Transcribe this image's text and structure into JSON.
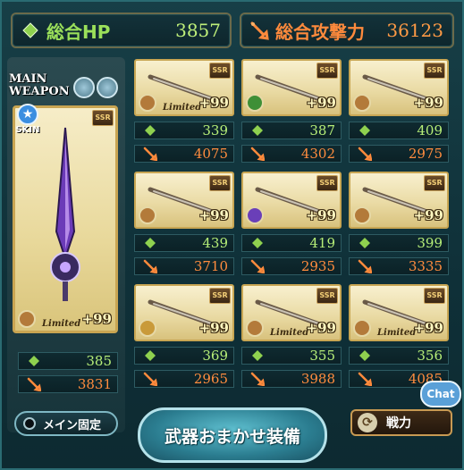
{
  "header": {
    "hp_label": "総合HP",
    "hp_value": "3857",
    "atk_label": "総合攻撃力",
    "atk_value": "36123"
  },
  "main_weapon": {
    "label_line1": "MAIN",
    "label_line2": "WEAPON",
    "skin_label": "SKIN",
    "rarity": "SSR",
    "plus": "+99",
    "tag": "Limited",
    "hp": "385",
    "atk": "3831"
  },
  "weapons": [
    {
      "rarity": "SSR",
      "plus": "+99",
      "tag": "Limited",
      "hp": "339",
      "atk": "4075",
      "element": "#b37a3a"
    },
    {
      "rarity": "SSR",
      "plus": "+99",
      "tag": "",
      "hp": "387",
      "atk": "4302",
      "element": "#3f8f36"
    },
    {
      "rarity": "SSR",
      "plus": "+99",
      "tag": "",
      "hp": "409",
      "atk": "2975",
      "element": "#b37a3a"
    },
    {
      "rarity": "SSR",
      "plus": "+99",
      "tag": "",
      "hp": "439",
      "atk": "3710",
      "element": "#b37a3a"
    },
    {
      "rarity": "SSR",
      "plus": "+99",
      "tag": "",
      "hp": "419",
      "atk": "2935",
      "element": "#6a3fb8"
    },
    {
      "rarity": "SSR",
      "plus": "+99",
      "tag": "",
      "hp": "399",
      "atk": "3335",
      "element": "#b37a3a"
    },
    {
      "rarity": "SSR",
      "plus": "+99",
      "tag": "",
      "hp": "369",
      "atk": "2965",
      "element": "#c99a3a"
    },
    {
      "rarity": "SSR",
      "plus": "+99",
      "tag": "Limited",
      "hp": "355",
      "atk": "3988",
      "element": "#b37a3a"
    },
    {
      "rarity": "SSR",
      "plus": "+99",
      "tag": "Limited",
      "hp": "356",
      "atk": "4085",
      "element": "#b37a3a"
    }
  ],
  "buttons": {
    "main_fix": "メイン固定",
    "auto_equip": "武器おまかせ装備",
    "power": "戦力",
    "chat": "Chat"
  },
  "colors": {
    "hp": "#9be05a",
    "atk": "#ff8a3c",
    "frame": "#2a6b72"
  }
}
